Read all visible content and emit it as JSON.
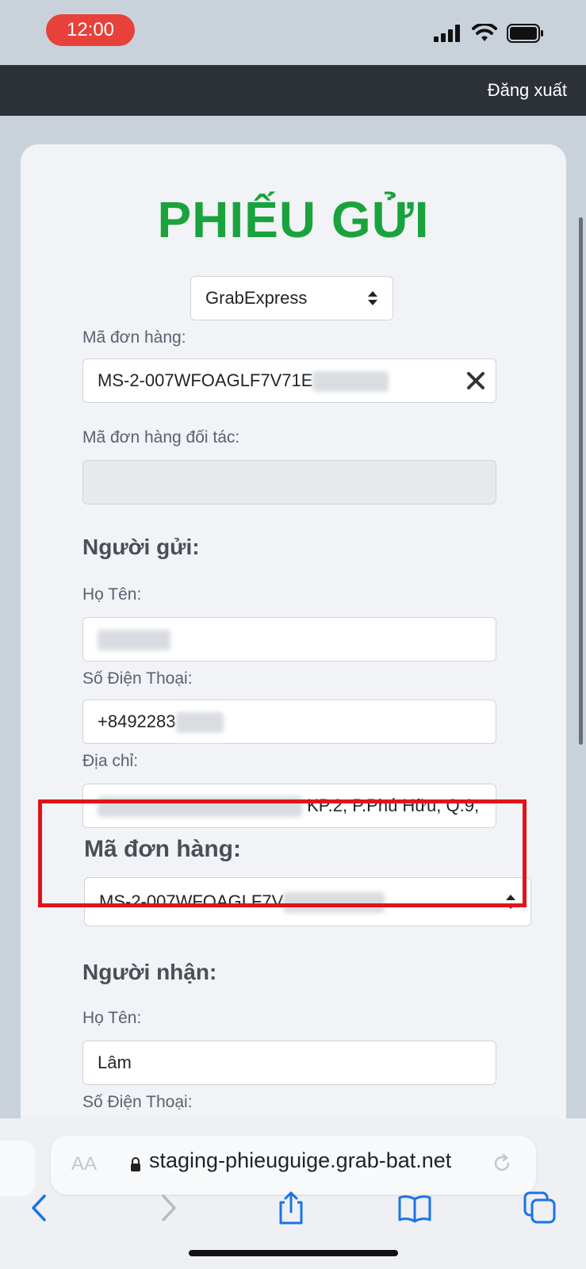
{
  "status_bar": {
    "time": "12:00"
  },
  "nav": {
    "logout": "Đăng xuất"
  },
  "form": {
    "title": "PHIẾU GỬI",
    "service_select": "GrabExpress",
    "order_code_label": "Mã đơn hàng:",
    "order_code_value": "MS-2-007WFOAGLF7V71E",
    "partner_code_label": "Mã đơn hàng đối tác:",
    "partner_code_value": "",
    "sender_heading": "Người gửi:",
    "sender_name_label": "Họ Tên:",
    "sender_phone_label": "Số Điện Thoại:",
    "sender_phone_value": "+8492283",
    "sender_address_label": "Địa chỉ:",
    "sender_address_value": "KP.2, P.Phú Hữu, Q.9,",
    "order_select_label": "Mã đơn hàng:",
    "order_select_value": "MS-2-007WFOAGLF7V",
    "receiver_heading": "Người nhận:",
    "receiver_name_label": "Họ Tên:",
    "receiver_name_value": "Lâm",
    "receiver_phone_label": "Số Điện Thoại:"
  },
  "browser": {
    "aa": "AA",
    "url": "staging-phieuguige.grab-bat.net"
  },
  "colors": {
    "title_green": "#1aa33c",
    "highlight_red": "#e0141b",
    "nav_dark": "#2c3138",
    "ios_blue": "#1a74e8"
  }
}
